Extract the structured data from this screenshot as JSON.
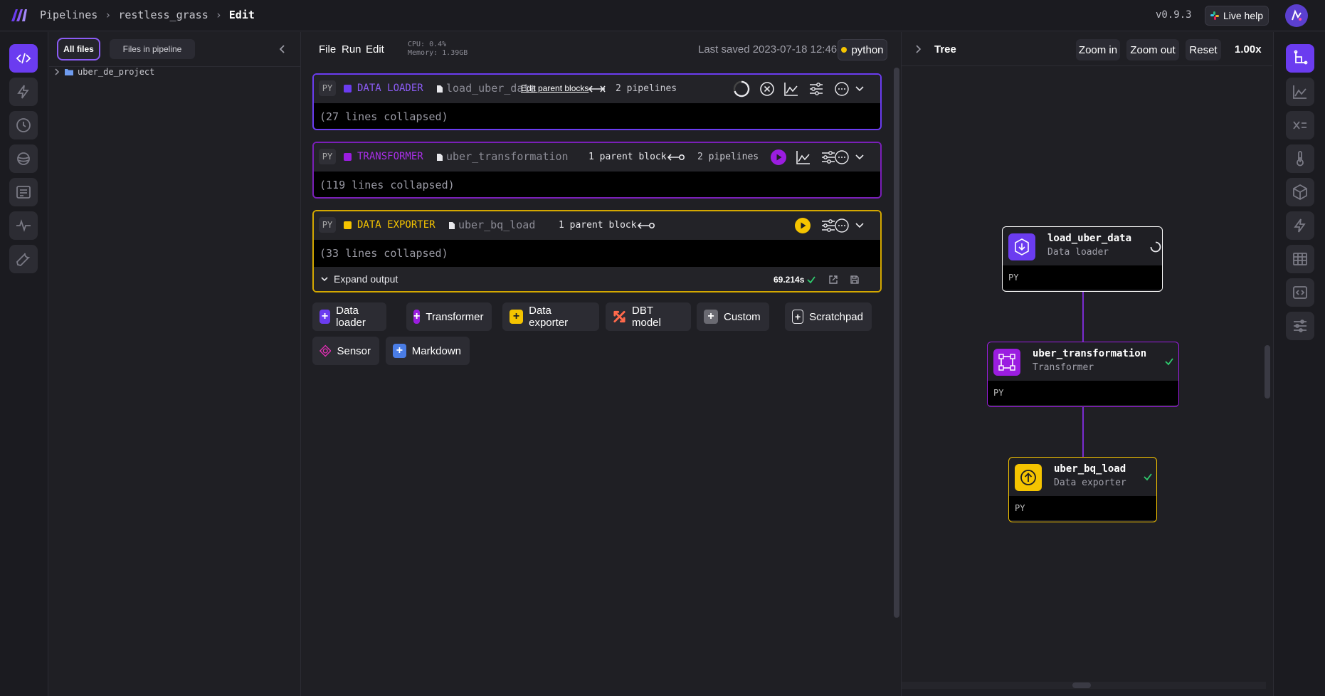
{
  "header": {
    "breadcrumb": [
      "Pipelines",
      "restless_grass",
      "Edit"
    ],
    "version": "v0.9.3",
    "live_help": "Live help"
  },
  "files": {
    "tab_all": "All files",
    "tab_pipeline": "Files in pipeline",
    "folder": "uber_de_project"
  },
  "editor": {
    "menu": [
      "File",
      "Run",
      "Edit"
    ],
    "cpu": "CPU: 0.4%",
    "memory": "Memory: 1.39GB",
    "last_saved": "Last saved 2023-07-18 12:46",
    "kernel": "python",
    "blocks": [
      {
        "lang": "PY",
        "type": "DATA LOADER",
        "name": "load_uber_data",
        "edit_parent": "Edit parent blocks",
        "pipelines": "2 pipelines",
        "collapsed": "(27 lines collapsed)",
        "color": "#6b3cf0"
      },
      {
        "lang": "PY",
        "type": "TRANSFORMER",
        "name": "uber_transformation",
        "parent": "1 parent block",
        "pipelines": "2 pipelines",
        "collapsed": "(119 lines collapsed)",
        "color": "#9b1de0"
      },
      {
        "lang": "PY",
        "type": "DATA EXPORTER",
        "name": "uber_bq_load",
        "parent": "1 parent block",
        "collapsed": "(33 lines collapsed)",
        "expand_output": "Expand output",
        "runtime": "69.214s",
        "color": "#f5c400"
      }
    ],
    "add_buttons": [
      "Data loader",
      "Transformer",
      "Data exporter",
      "DBT model",
      "Custom",
      "Scratchpad",
      "Sensor",
      "Markdown"
    ]
  },
  "tree": {
    "title": "Tree",
    "zoom_in": "Zoom in",
    "zoom_out": "Zoom out",
    "reset": "Reset",
    "zoom_level": "1.00x",
    "nodes": [
      {
        "name": "load_uber_data",
        "type": "Data loader",
        "lang": "PY"
      },
      {
        "name": "uber_transformation",
        "type": "Transformer",
        "lang": "PY"
      },
      {
        "name": "uber_bq_load",
        "type": "Data exporter",
        "lang": "PY"
      }
    ]
  }
}
